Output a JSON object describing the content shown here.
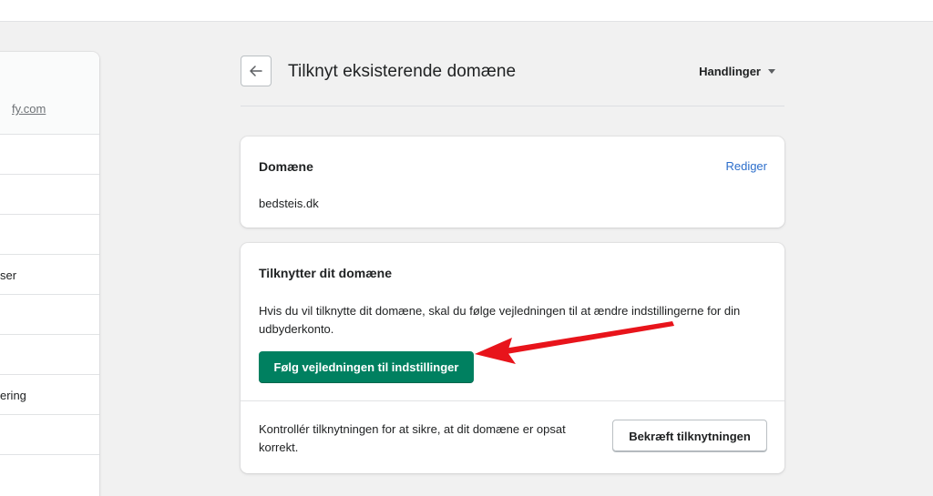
{
  "colors": {
    "primary": "#008060",
    "link": "#2c6ecb",
    "annotation_arrow": "#e8141b",
    "background": "#f1f1f1"
  },
  "sidebar": {
    "store_link": "fy.com",
    "items": [
      {
        "label": ""
      },
      {
        "label": ""
      },
      {
        "label": ""
      },
      {
        "label": "ser"
      },
      {
        "label": ""
      },
      {
        "label": ""
      },
      {
        "label": "ering"
      },
      {
        "label": ""
      }
    ]
  },
  "header": {
    "back_icon": "arrow-left-icon",
    "title": "Tilknyt eksisterende domæne",
    "actions_label": "Handlinger",
    "actions_icon": "caret-down-icon"
  },
  "domain_card": {
    "title": "Domæne",
    "edit_label": "Rediger",
    "domain": "bedsteis.dk"
  },
  "connect_card": {
    "title": "Tilknytter dit domæne",
    "description": "Hvis du vil tilknytte dit domæne, skal du følge vejledningen til at ændre indstillingerne for din udbyderkonto.",
    "primary_button": "Følg vejledningen til indstillinger",
    "verify_text": "Kontrollér tilknytningen for at sikre, at dit domæne er opsat korrekt.",
    "verify_button": "Bekræft tilknytningen"
  }
}
